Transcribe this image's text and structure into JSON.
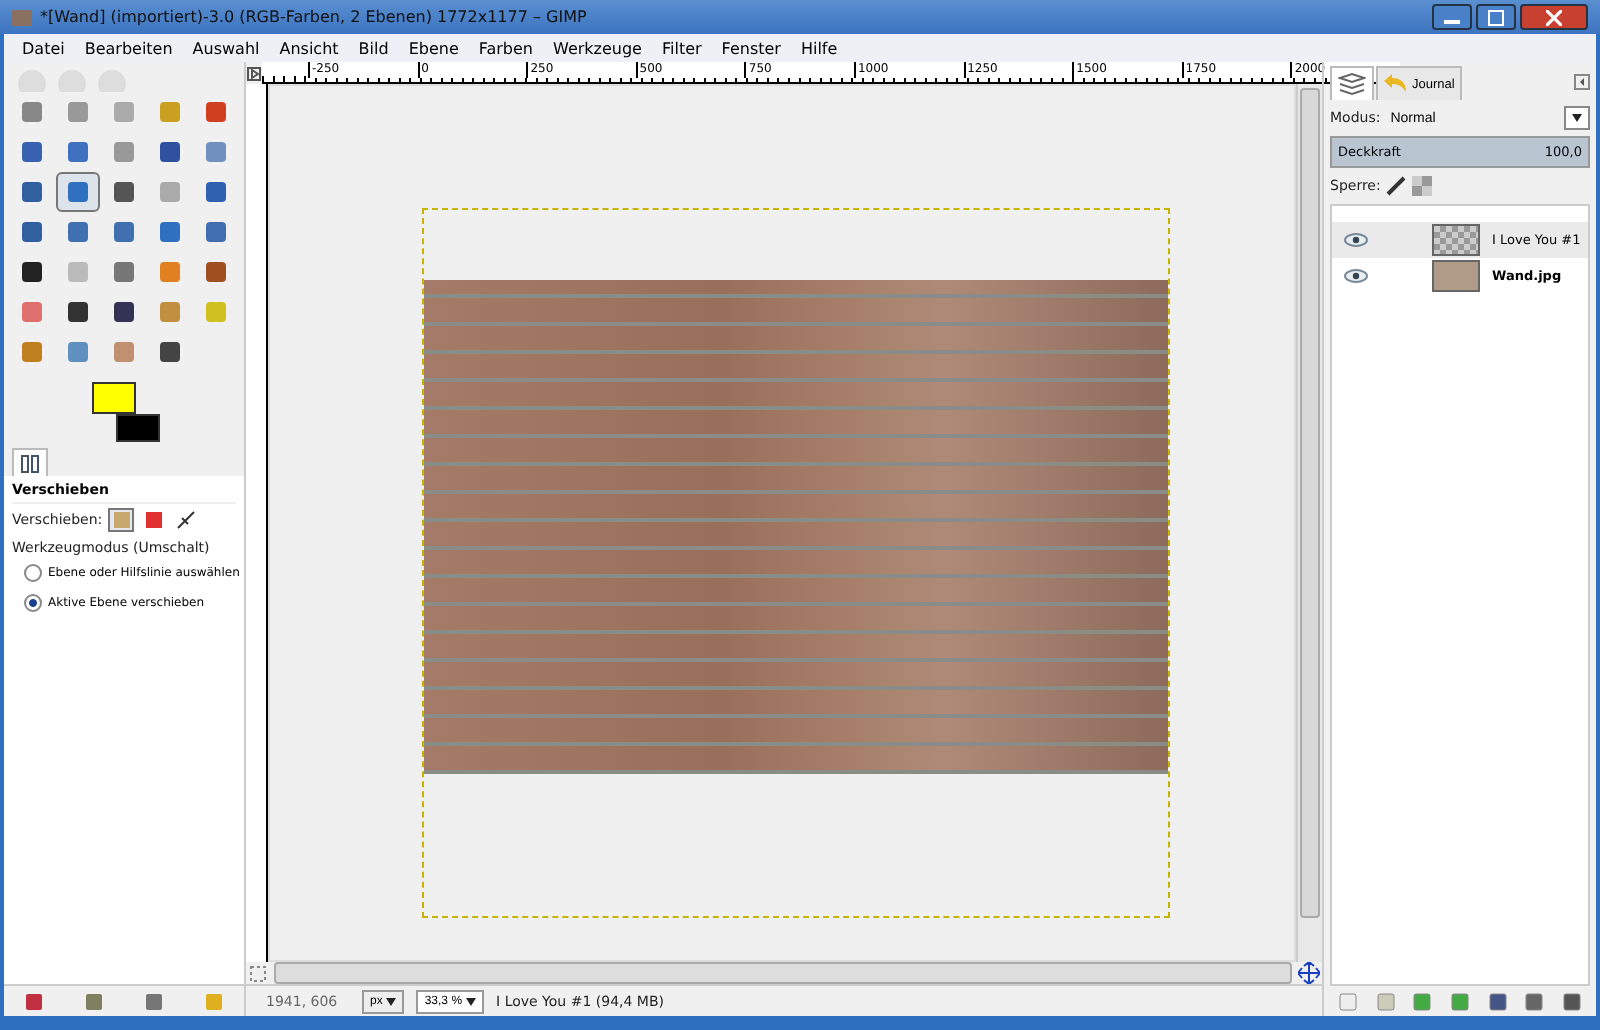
{
  "window": {
    "title": "*[Wand] (importiert)-3.0 (RGB-Farben, 2 Ebenen) 1772x1177 – GIMP"
  },
  "menu": [
    "Datei",
    "Bearbeiten",
    "Auswahl",
    "Ansicht",
    "Bild",
    "Ebene",
    "Farben",
    "Werkzeuge",
    "Filter",
    "Fenster",
    "Hilfe"
  ],
  "toolbox": {
    "tools": [
      {
        "selected": false
      },
      {
        "selected": false
      },
      {
        "selected": false
      },
      {
        "selected": false
      },
      {
        "selected": false
      },
      {
        "selected": false
      },
      {
        "selected": false
      },
      {
        "selected": false
      },
      {
        "selected": false
      },
      {
        "selected": false
      },
      {
        "selected": false
      },
      {
        "selected": true
      },
      {
        "selected": false
      },
      {
        "selected": false
      },
      {
        "selected": false
      },
      {
        "selected": false
      },
      {
        "selected": false
      },
      {
        "selected": false
      },
      {
        "selected": false
      },
      {
        "selected": false
      },
      {
        "selected": false
      },
      {
        "selected": false
      },
      {
        "selected": false
      },
      {
        "selected": false
      },
      {
        "selected": false
      },
      {
        "selected": false
      },
      {
        "selected": false
      },
      {
        "selected": false
      },
      {
        "selected": false
      },
      {
        "selected": false
      },
      {
        "selected": false
      },
      {
        "selected": false
      },
      {
        "selected": false
      },
      {
        "selected": false
      }
    ],
    "foreground": {
      "color": "#ffff00"
    },
    "background": {
      "color": "#000000"
    }
  },
  "tool_options": {
    "title": "Verschieben",
    "move_label": "Verschieben:",
    "move_targets": [
      {
        "selected": true
      },
      {
        "selected": false
      },
      {
        "selected": false
      }
    ],
    "mode_label": "Werkzeugmodus (Umschalt)",
    "options": [
      {
        "label": "Ebene oder Hilfslinie auswählen",
        "selected": false
      },
      {
        "label": "Aktive Ebene verschieben",
        "selected": true
      }
    ]
  },
  "ruler": {
    "labels": [
      "-250",
      "0",
      "250",
      "500",
      "750",
      "1000",
      "1250",
      "1500",
      "1750",
      "2000"
    ]
  },
  "status_bar": {
    "coordinates": "1941, 606",
    "unit": "px",
    "zoom": "33,3 %",
    "message": "I Love You #1 (94,4 MB)"
  },
  "layers_dock": {
    "tabs": [
      {
        "selected": true
      },
      {
        "label": "Journal",
        "selected": false
      }
    ],
    "mode_label": "Modus:",
    "mode_value": "Normal",
    "opacity_label": "Deckkraft",
    "opacity_value": "100,0",
    "opacity": {
      "level": 1
    },
    "lock_label": "Sperre:",
    "layers": [
      {
        "name": "I Love You #1",
        "kind": "text",
        "selected": true,
        "visible": true
      },
      {
        "name": "Wand.jpg",
        "kind": "image",
        "selected": false,
        "visible": true
      }
    ]
  }
}
